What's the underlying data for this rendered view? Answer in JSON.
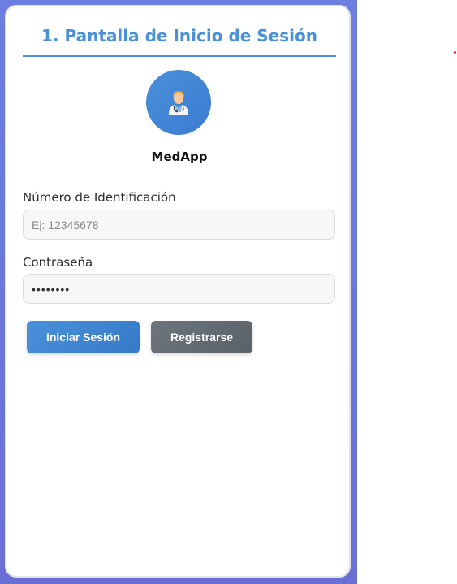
{
  "page": {
    "title": "1. Pantalla de Inicio de Sesión",
    "app_name": "MedApp",
    "avatar_icon": "doctor-icon"
  },
  "form": {
    "id_label": "Número de Identificación",
    "id_placeholder": "Ej: 12345678",
    "id_value": "",
    "password_label": "Contraseña",
    "password_value": "password"
  },
  "actions": {
    "login_label": "Iniciar Sesión",
    "register_label": "Registrarse"
  },
  "colors": {
    "accent": "#4a90d9",
    "secondary": "#6c757d",
    "frame": "#6a6fd6"
  }
}
